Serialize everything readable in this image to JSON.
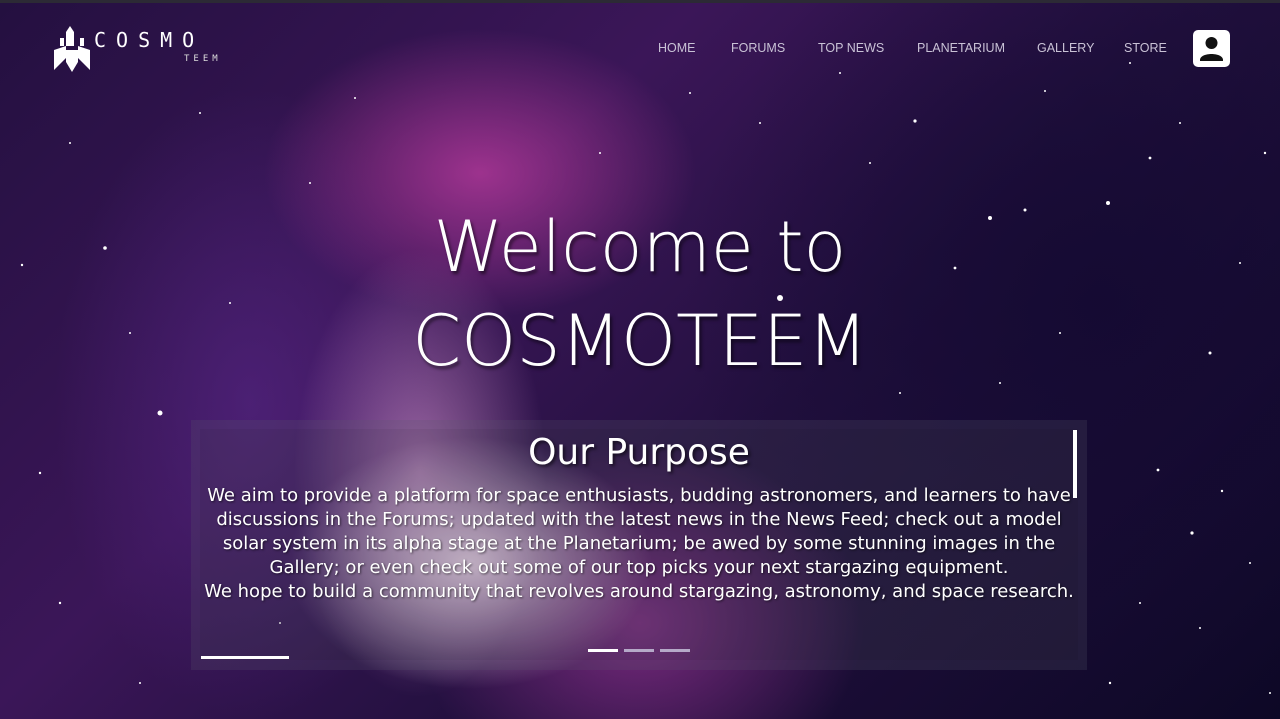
{
  "brand": {
    "wordmark": "COSMO",
    "sub": "TEEM"
  },
  "nav": {
    "items": [
      {
        "label": "HOME"
      },
      {
        "label": "FORUMS"
      },
      {
        "label": "TOP NEWS"
      },
      {
        "label": "PLANETARIUM"
      },
      {
        "label": "GALLERY"
      },
      {
        "label": "STORE"
      }
    ],
    "user_icon": "user-icon"
  },
  "hero": {
    "line1": "Welcome to",
    "line2": "COSMOTEEM"
  },
  "purpose": {
    "title": "Our Purpose",
    "paragraph1": "We aim to provide a platform for space enthusiasts, budding astronomers, and learners to have discussions in the Forums; updated with the latest news in the News Feed; check out a model solar system in its alpha stage at the Planetarium; be awed by some stunning images in the Gallery; or even check out some of our top picks your next stargazing equipment.",
    "paragraph2": "We hope to build a community that revolves around stargazing, astronomy, and space research.",
    "slides_total": 3,
    "slide_active": 1
  },
  "colors": {
    "nav_text": "#c9c2d6",
    "accent": "#ffffff",
    "panel_bg": "rgba(90,90,110,0.22)"
  }
}
